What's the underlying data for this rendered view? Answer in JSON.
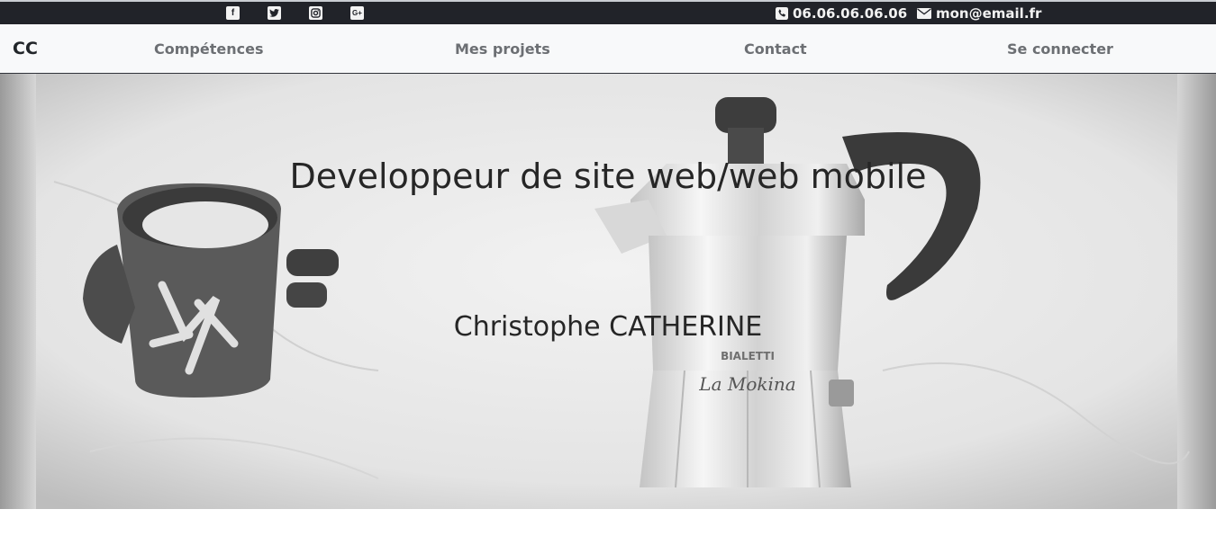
{
  "topbar": {
    "social": [
      {
        "icon": "facebook-icon",
        "glyph": "f"
      },
      {
        "icon": "twitter-icon",
        "glyph": ""
      },
      {
        "icon": "instagram-icon",
        "glyph": ""
      },
      {
        "icon": "google-plus-icon",
        "glyph": "G+"
      }
    ],
    "phone": "06.06.06.06.06",
    "email": "mon@email.fr"
  },
  "navbar": {
    "brand": "CC",
    "links": [
      "Compétences",
      "Mes projets",
      "Contact",
      "Se connecter"
    ]
  },
  "hero": {
    "title": "Developpeur de site web/web mobile",
    "name": "Christophe CATHERINE",
    "mug_brand": "BIALETTI",
    "pot_label": "La Mokina"
  },
  "colors": {
    "topbar_bg": "#212329",
    "navbar_bg": "#f8f9fa",
    "link": "#6c6f73",
    "hero_text": "#262626"
  }
}
